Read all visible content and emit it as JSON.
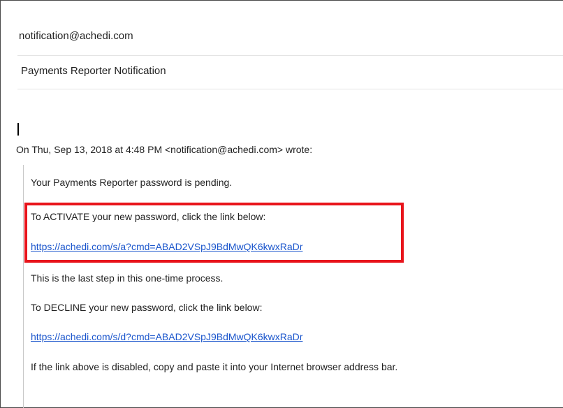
{
  "email": {
    "from": "notification@achedi.com",
    "subject": "Payments Reporter Notification",
    "attribution": "On Thu, Sep 13, 2018 at 4:48 PM <notification@achedi.com> wrote:",
    "body": {
      "line_pending": "Your Payments Reporter password is pending.",
      "line_activate": "To ACTIVATE your new password, click the link below:",
      "link_activate": "https://achedi.com/s/a?cmd=ABAD2VSpJ9BdMwQK6kwxRaDr",
      "line_last_step": "This is the last step in this one-time process.",
      "line_decline": "To DECLINE your new password, click the link below:",
      "link_decline": "https://achedi.com/s/d?cmd=ABAD2VSpJ9BdMwQK6kwxRaDr",
      "line_disabled": "If the link above is disabled, copy and paste it into your Internet browser address bar."
    }
  },
  "colors": {
    "link": "#1a55cc",
    "highlight_box": "#e8141b",
    "text": "#222222"
  }
}
